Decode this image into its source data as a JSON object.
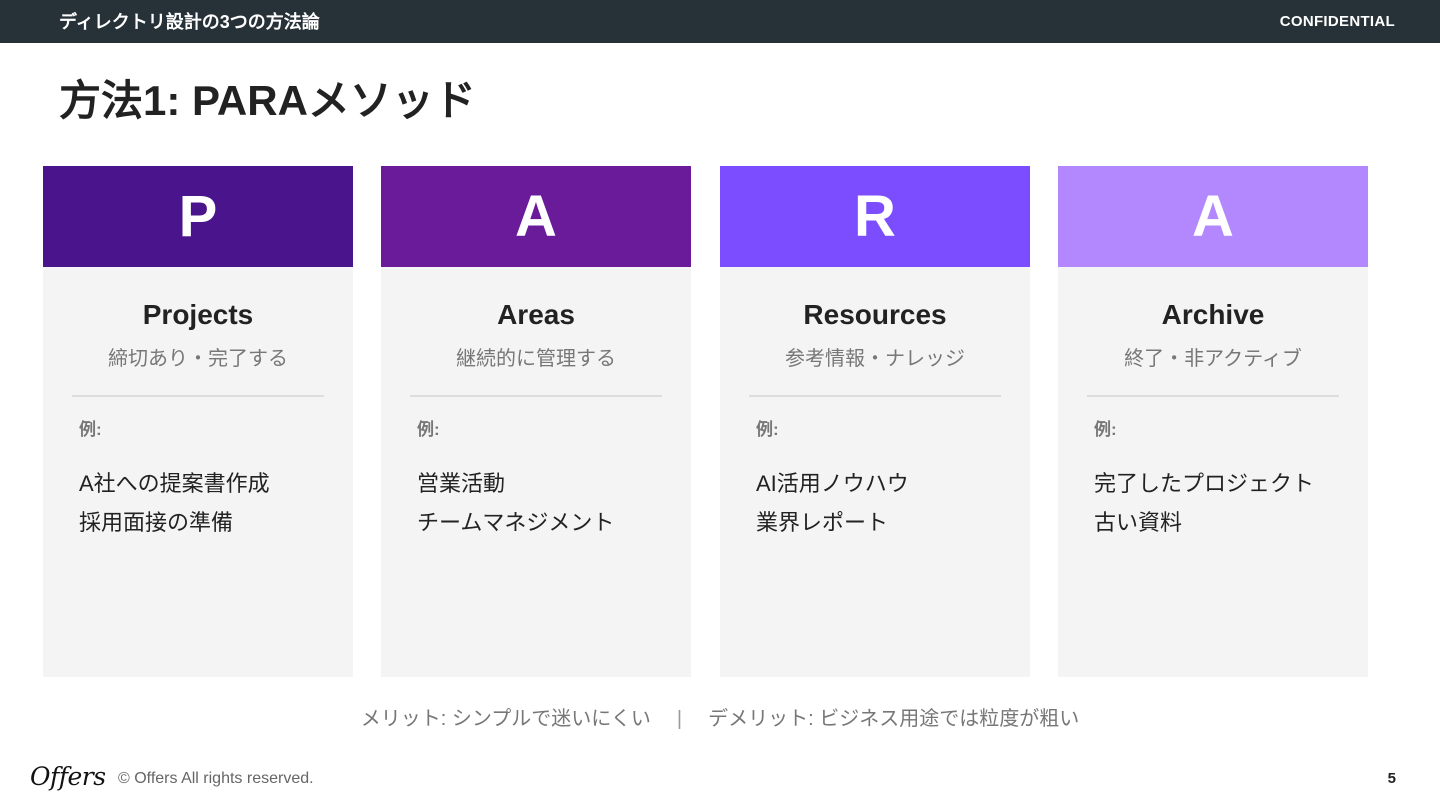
{
  "header": {
    "deck_title": "ディレクトリ設計の3つの方法論",
    "confidential": "CONFIDENTIAL"
  },
  "slide": {
    "title": "方法1: PARAメソッド"
  },
  "cards": [
    {
      "letter": "P",
      "color": "#4a148c",
      "name": "Projects",
      "description": "締切あり・完了する",
      "examples_label": "例:",
      "examples": [
        "A社への提案書作成",
        "採用面接の準備"
      ]
    },
    {
      "letter": "A",
      "color": "#6a1b9a",
      "name": "Areas",
      "description": "継続的に管理する",
      "examples_label": "例:",
      "examples": [
        "営業活動",
        "チームマネジメント"
      ]
    },
    {
      "letter": "R",
      "color": "#7c4dff",
      "name": "Resources",
      "description": "参考情報・ナレッジ",
      "examples_label": "例:",
      "examples": [
        "AI活用ノウハウ",
        "業界レポート"
      ]
    },
    {
      "letter": "A",
      "color": "#b388ff",
      "name": "Archive",
      "description": "終了・非アクティブ",
      "examples_label": "例:",
      "examples": [
        "完了したプロジェクト",
        "古い資料"
      ]
    }
  ],
  "summary": {
    "merit": "メリット: シンプルで迷いにくい",
    "separator": "|",
    "demerit": "デメリット: ビジネス用途では粒度が粗い"
  },
  "footer": {
    "logo": "Offers",
    "copyright": "© Offers All rights reserved.",
    "page_number": "5"
  }
}
